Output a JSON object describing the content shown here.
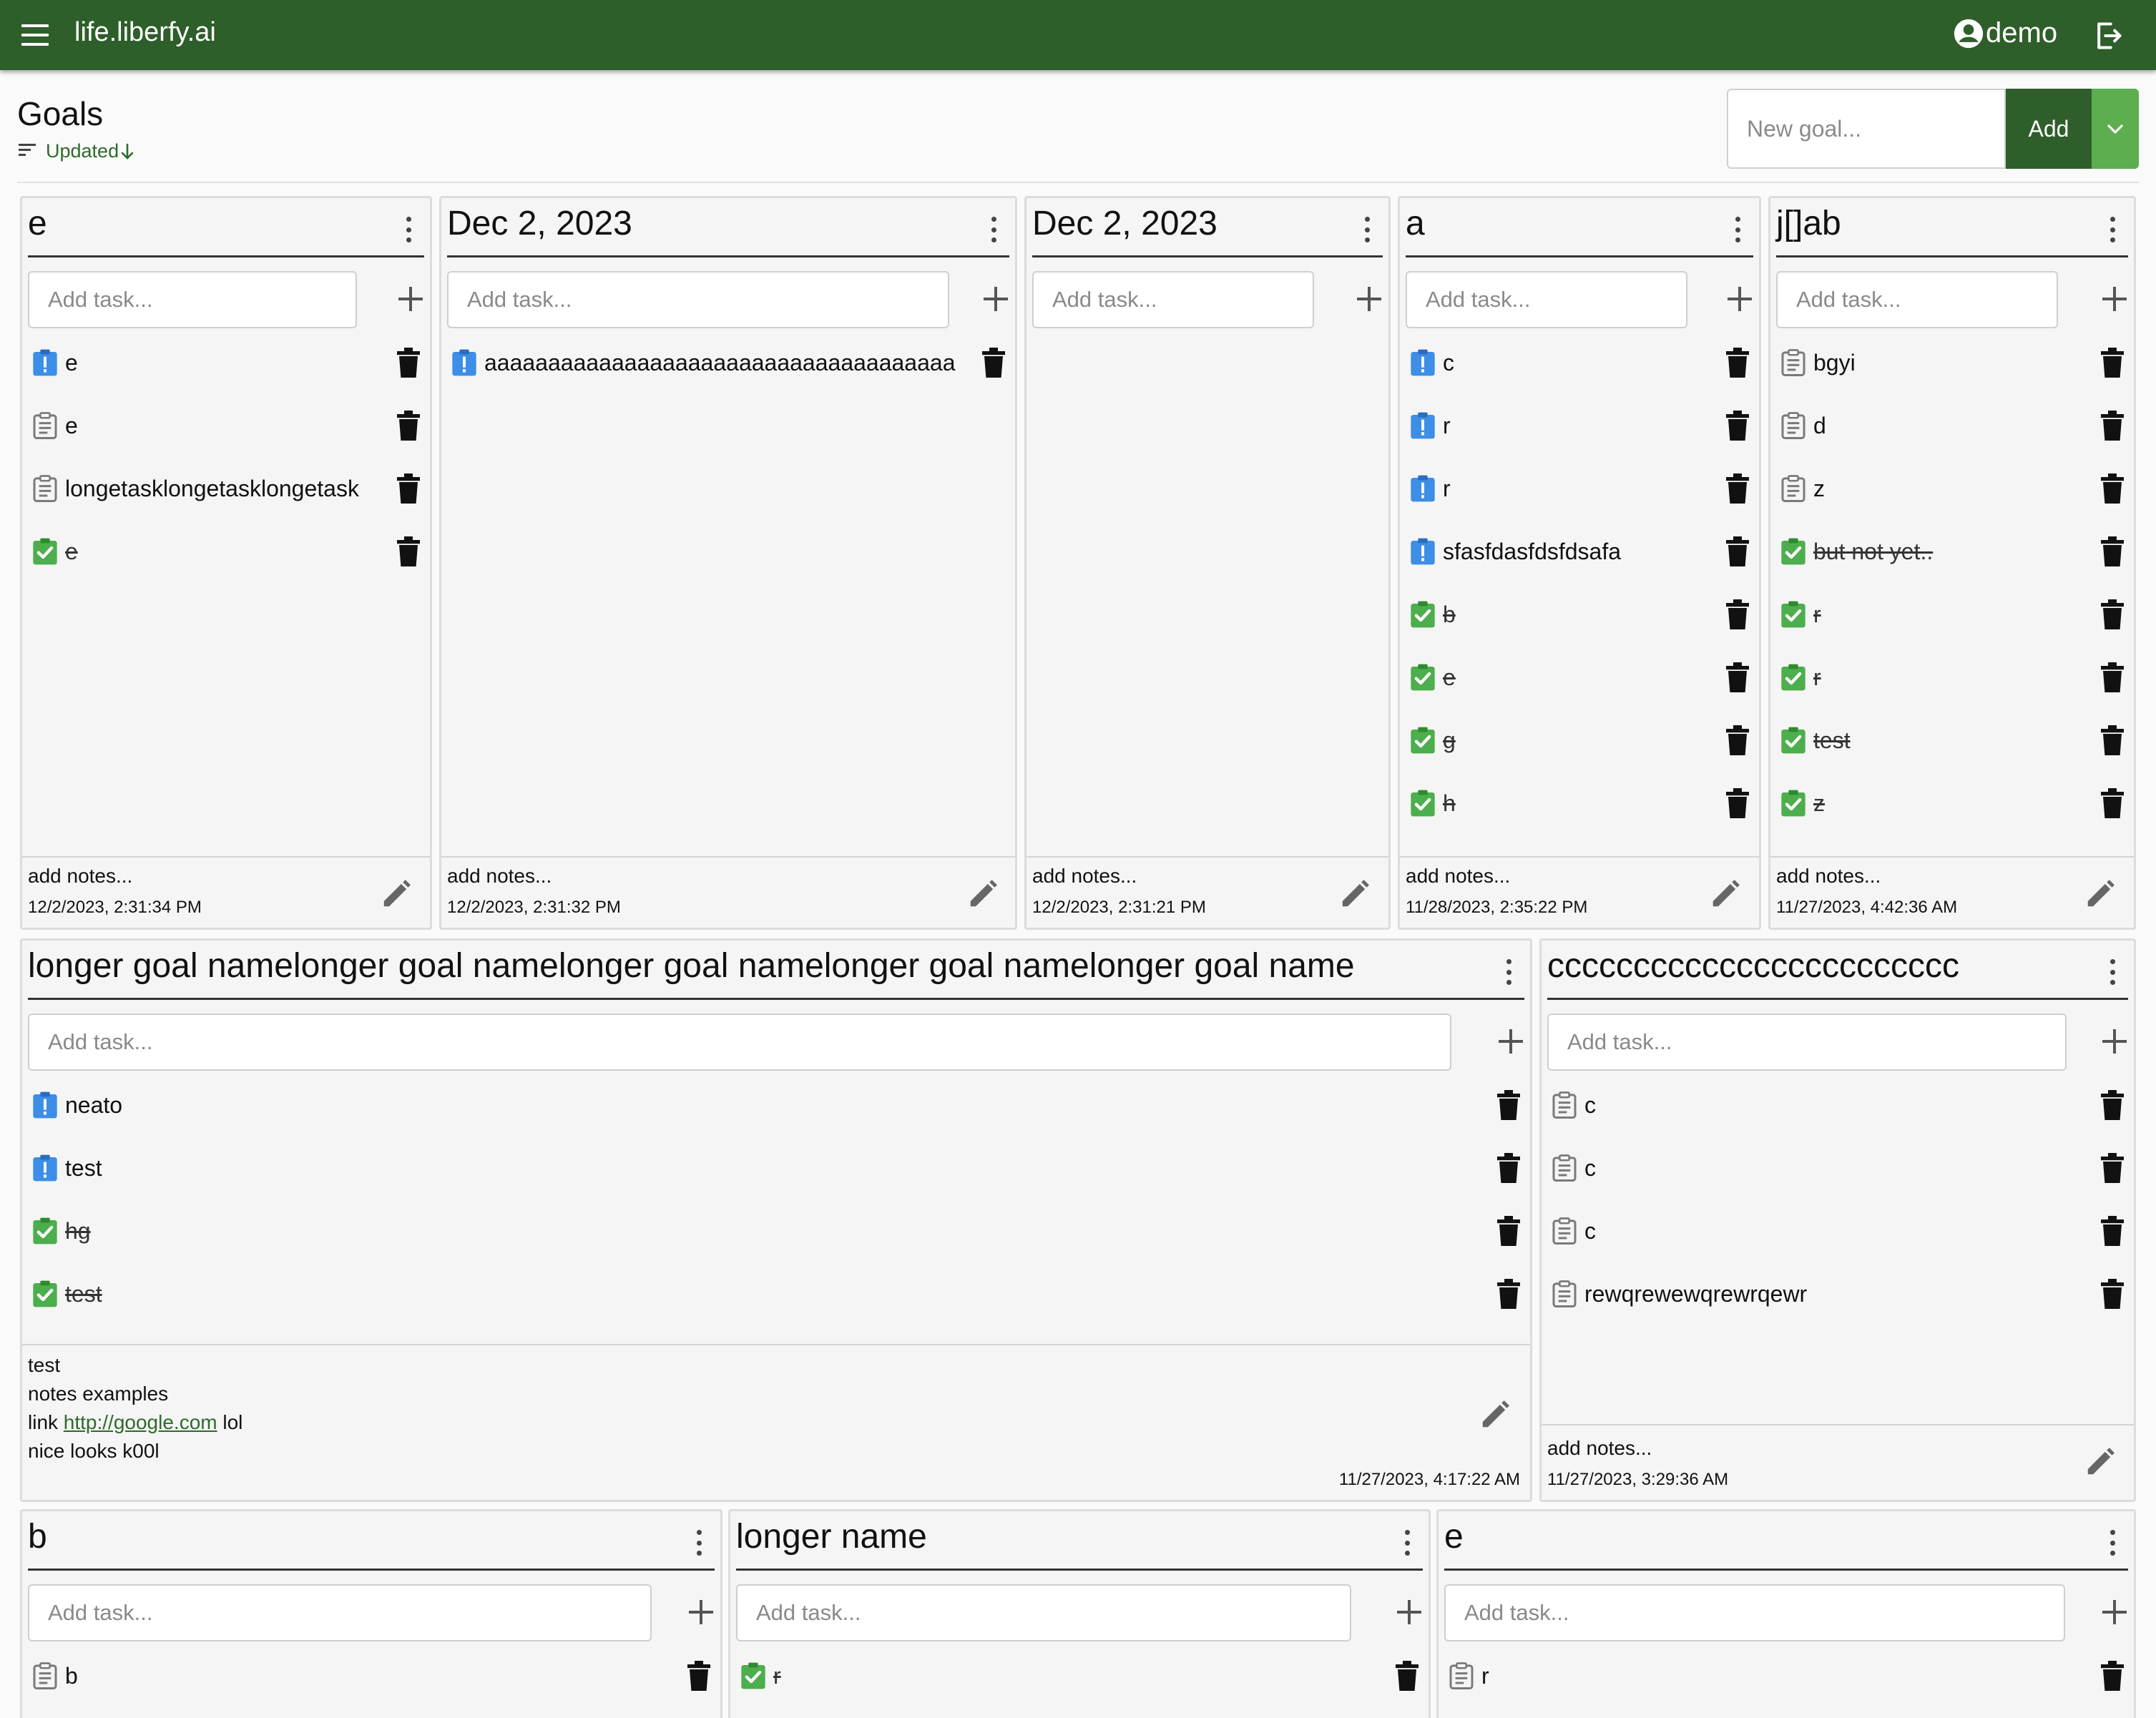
{
  "app": {
    "brand": "life.liberfy.ai",
    "user": "demo"
  },
  "header": {
    "title": "Goals",
    "sort_label": "Updated",
    "new_goal_placeholder": "New goal...",
    "add_label": "Add"
  },
  "task_placeholder": "Add task...",
  "colors": {
    "appbar": "#2e5e2a",
    "todo": "#3d8ee6",
    "done": "#4cae4c",
    "link": "#2e6b2a"
  },
  "goals": [
    {
      "title": "e",
      "notes": "add notes...",
      "updated": "12/2/2023, 2:31:34 PM",
      "tasks": [
        {
          "label": "e",
          "state": "todo"
        },
        {
          "label": "e",
          "state": "note"
        },
        {
          "label": "longetasklongetasklongetask",
          "state": "note"
        },
        {
          "label": "e",
          "state": "done"
        }
      ]
    },
    {
      "title": "Dec 2, 2023",
      "notes": "add notes...",
      "updated": "12/2/2023, 2:31:32 PM",
      "tasks": [
        {
          "label": "aaaaaaaaaaaaaaaaaaaaaaaaaaaaaaaaaaaaa",
          "state": "todo"
        }
      ]
    },
    {
      "title": "Dec 2, 2023",
      "notes": "add notes...",
      "updated": "12/2/2023, 2:31:21 PM",
      "tasks": []
    },
    {
      "title": "a",
      "notes": "add notes...",
      "updated": "11/28/2023, 2:35:22 PM",
      "tasks": [
        {
          "label": "c",
          "state": "todo"
        },
        {
          "label": "r",
          "state": "todo"
        },
        {
          "label": "r",
          "state": "todo"
        },
        {
          "label": "sfasfdasfdsfdsafa",
          "state": "todo"
        },
        {
          "label": "b",
          "state": "done"
        },
        {
          "label": "e",
          "state": "done"
        },
        {
          "label": "g",
          "state": "done"
        },
        {
          "label": "h",
          "state": "done"
        }
      ]
    },
    {
      "title": "j[]ab",
      "notes": "add notes...",
      "updated": "11/27/2023, 4:42:36 AM",
      "tasks": [
        {
          "label": "bgyi",
          "state": "note"
        },
        {
          "label": "d",
          "state": "note"
        },
        {
          "label": "z",
          "state": "note"
        },
        {
          "label": "but not yet..",
          "state": "done"
        },
        {
          "label": "r",
          "state": "done"
        },
        {
          "label": "r",
          "state": "done"
        },
        {
          "label": "test",
          "state": "done"
        },
        {
          "label": "z",
          "state": "done"
        }
      ]
    },
    {
      "title": "longer goal namelonger goal namelonger goal namelonger goal namelonger goal name",
      "notes_lines": [
        "test",
        "notes examples"
      ],
      "notes_link_prefix": "link ",
      "notes_link": "http://google.com",
      "notes_link_suffix": " lol",
      "notes_last": "nice looks k00l",
      "updated": "11/27/2023, 4:17:22 AM",
      "tasks": [
        {
          "label": "neato",
          "state": "todo"
        },
        {
          "label": "test",
          "state": "todo"
        },
        {
          "label": "hg",
          "state": "done"
        },
        {
          "label": "test",
          "state": "done"
        }
      ]
    },
    {
      "title": "cccccccccccccccccccccccc",
      "notes": "add notes...",
      "updated": "11/27/2023, 3:29:36 AM",
      "tasks": [
        {
          "label": "c",
          "state": "note"
        },
        {
          "label": "c",
          "state": "note"
        },
        {
          "label": "c",
          "state": "note"
        },
        {
          "label": "rewqrewewqrewrqewr",
          "state": "note"
        }
      ]
    },
    {
      "title": "b",
      "tasks": [
        {
          "label": "b",
          "state": "note"
        }
      ]
    },
    {
      "title": "longer name",
      "tasks": [
        {
          "label": "r",
          "state": "done"
        }
      ]
    },
    {
      "title": "e",
      "tasks": [
        {
          "label": "r",
          "state": "note"
        }
      ]
    }
  ]
}
